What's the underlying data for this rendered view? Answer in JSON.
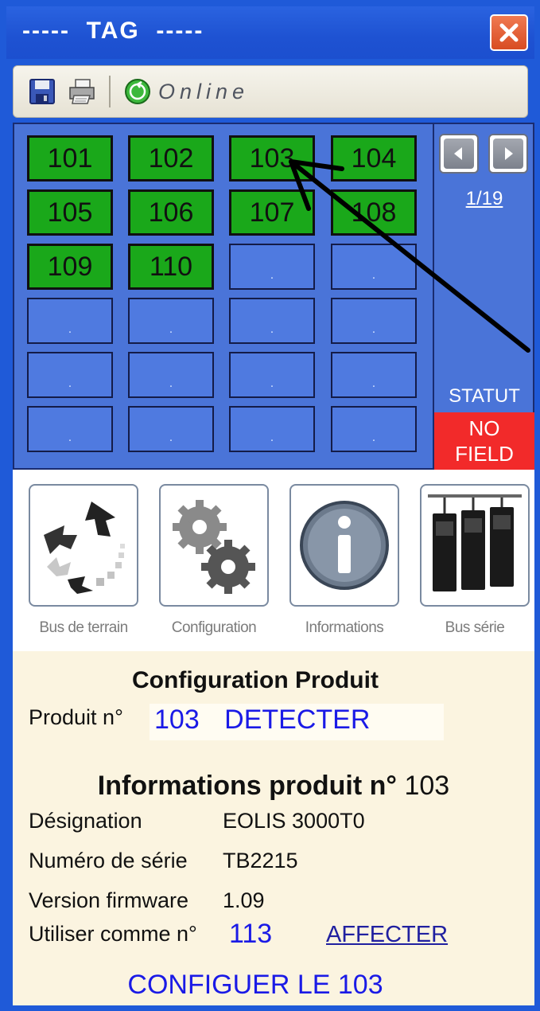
{
  "window": {
    "title": "-----  TAG  -----",
    "close_icon": "close-icon"
  },
  "toolbar": {
    "save_icon": "save-icon",
    "print_icon": "print-icon",
    "online_icon": "online-icon",
    "online_label": "Online"
  },
  "grid": {
    "slots": [
      {
        "label": "101",
        "state": "filled"
      },
      {
        "label": "102",
        "state": "filled"
      },
      {
        "label": "103",
        "state": "filled"
      },
      {
        "label": "104",
        "state": "filled"
      },
      {
        "label": "105",
        "state": "filled"
      },
      {
        "label": "106",
        "state": "filled"
      },
      {
        "label": "107",
        "state": "filled"
      },
      {
        "label": "108",
        "state": "filled"
      },
      {
        "label": "109",
        "state": "filled"
      },
      {
        "label": "110",
        "state": "filled"
      },
      {
        "label": ".",
        "state": "empty"
      },
      {
        "label": ".",
        "state": "empty"
      },
      {
        "label": ".",
        "state": "empty"
      },
      {
        "label": ".",
        "state": "empty"
      },
      {
        "label": ".",
        "state": "empty"
      },
      {
        "label": ".",
        "state": "empty"
      },
      {
        "label": ".",
        "state": "empty"
      },
      {
        "label": ".",
        "state": "empty"
      },
      {
        "label": ".",
        "state": "empty"
      },
      {
        "label": ".",
        "state": "empty"
      },
      {
        "label": ".",
        "state": "empty"
      },
      {
        "label": ".",
        "state": "empty"
      },
      {
        "label": ".",
        "state": "empty"
      },
      {
        "label": ".",
        "state": "empty"
      }
    ],
    "filled_color": "#1aa81a",
    "empty_color": "#4f7ae0"
  },
  "side": {
    "prev_icon": "chevron-left-icon",
    "next_icon": "chevron-right-icon",
    "page_indicator": "1/19",
    "statut_label": "STATUT",
    "status_line1": "NO",
    "status_line2": "FIELD",
    "status_color": "#f22a2a"
  },
  "icon_buttons": [
    {
      "label": "Bus de terrain",
      "icon": "fieldbus-icon"
    },
    {
      "label": "Configuration",
      "icon": "gears-icon"
    },
    {
      "label": "Informations",
      "icon": "info-icon"
    },
    {
      "label": "Bus série",
      "icon": "serial-bus-icon"
    }
  ],
  "config": {
    "title": "Configuration Produit",
    "produit_label": "Produit n°",
    "produit_value": "103 DETECTER"
  },
  "info": {
    "title_prefix": "Informations produit n°",
    "title_number": "103",
    "rows": [
      {
        "label": "Désignation",
        "value": "EOLIS 3000T0"
      },
      {
        "label": "Numéro de série",
        "value": "TB2215"
      },
      {
        "label": "Version firmware",
        "value": "1.09"
      }
    ],
    "use_label": "Utiliser comme n°",
    "use_value": "113",
    "affecter_label": "AFFECTER",
    "configurer_label": "CONFIGUER LE 103"
  }
}
